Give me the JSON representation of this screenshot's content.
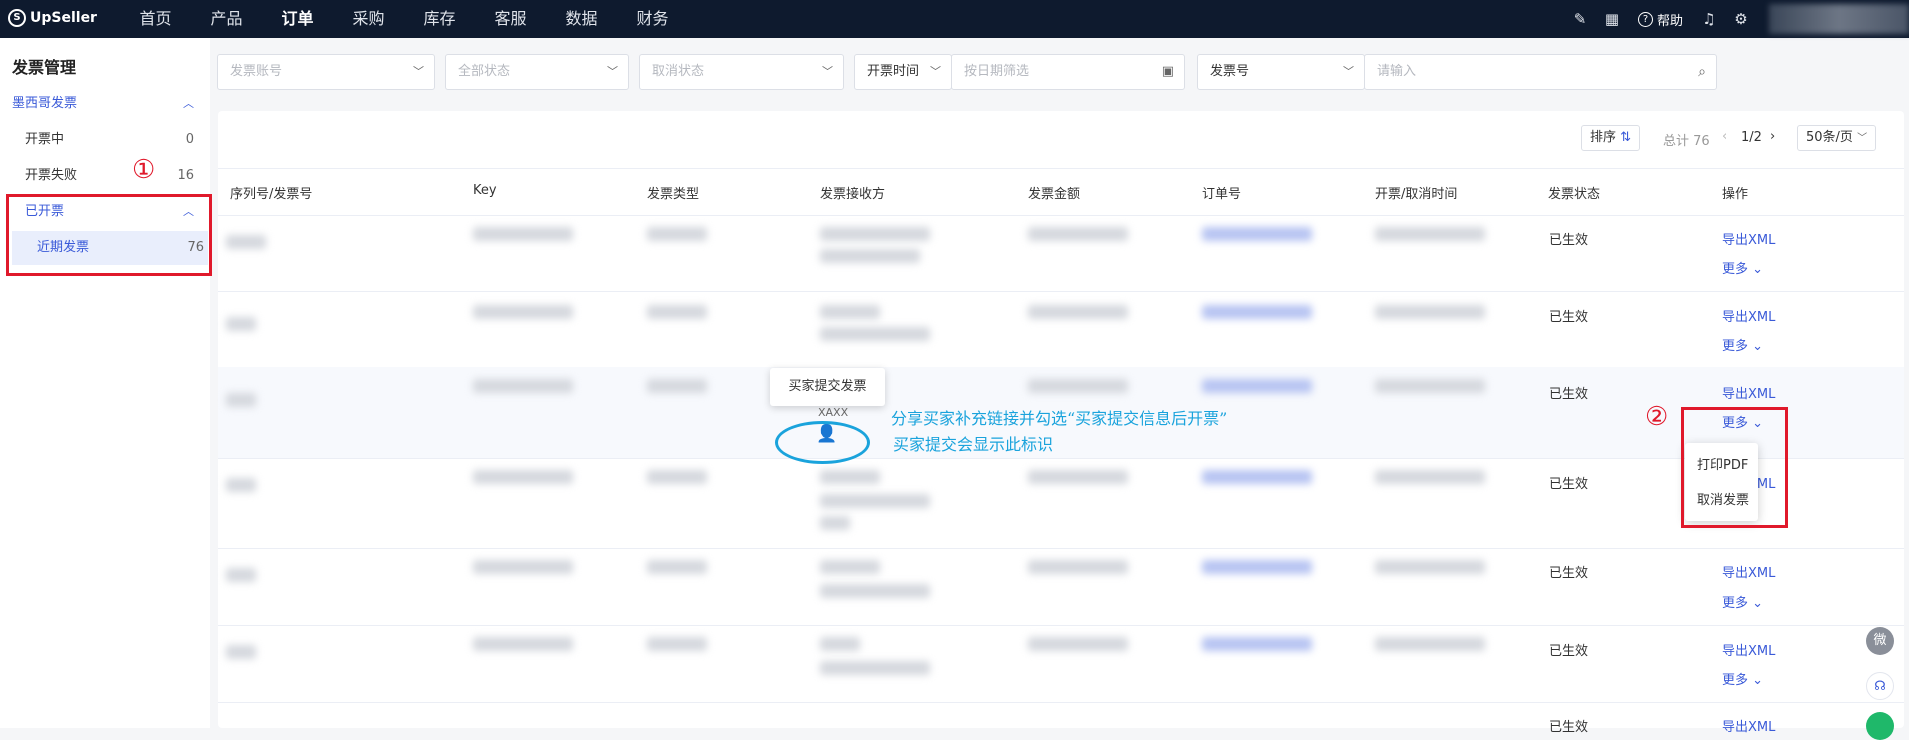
{
  "app": {
    "logo_text": "UpSeller"
  },
  "nav": [
    "首页",
    "产品",
    "订单",
    "采购",
    "库存",
    "客服",
    "数据",
    "财务"
  ],
  "top_right": {
    "help_label": "帮助"
  },
  "sidebar": {
    "title": "发票管理",
    "group1": "墨西哥发票",
    "issuing": {
      "label": "开票中",
      "count": "0"
    },
    "failed": {
      "label": "开票失败",
      "count": "16"
    },
    "group2": "已开票",
    "recent": {
      "label": "近期发票",
      "count": "76"
    }
  },
  "filters": {
    "account_placeholder": "发票账号",
    "status_placeholder": "全部状态",
    "cancel_placeholder": "取消状态",
    "time_type": "开票时间",
    "date_placeholder": "按日期筛选",
    "search_type": "发票号",
    "search_placeholder": "请输入"
  },
  "toolbar": {
    "sort": "排序",
    "total": "总计 76",
    "page": "1/2",
    "page_size": "50条/页"
  },
  "columns": [
    "序列号/发票号",
    "Key",
    "发票类型",
    "发票接收方",
    "发票金额",
    "订单号",
    "开票/取消时间",
    "发票状态",
    "操作"
  ],
  "rows": [
    {
      "status": "已生效",
      "xml": "导出XML",
      "more": "更多"
    },
    {
      "status": "已生效",
      "xml": "导出XML",
      "more": "更多"
    },
    {
      "status": "已生效",
      "xml": "导出XML",
      "more": "更多"
    },
    {
      "status": "已生效",
      "xml": "导出XML",
      "more": ""
    },
    {
      "status": "已生效",
      "xml": "导出XML",
      "more": "更多"
    },
    {
      "status": "已生效",
      "xml": "导出XML",
      "more": "更多"
    },
    {
      "status": "已生效",
      "xml": "导出XML",
      "more": ""
    }
  ],
  "tooltip": "买家提交发票",
  "receiver_partial": "XAXX",
  "dropdown": {
    "print_pdf": "打印PDF",
    "cancel_invoice": "取消发票"
  },
  "annotations": {
    "mark1": "①",
    "mark2": "②",
    "line1": "分享买家补充链接并勾选“买家提交信息后开票”",
    "line2": "买家提交会显示此标识"
  },
  "float": {
    "wechat": "微"
  },
  "colors": {
    "accent": "#3a5ad8",
    "topbar": "#0e1a2e",
    "red": "#e0192b",
    "annotation": "#1aa3dc"
  }
}
